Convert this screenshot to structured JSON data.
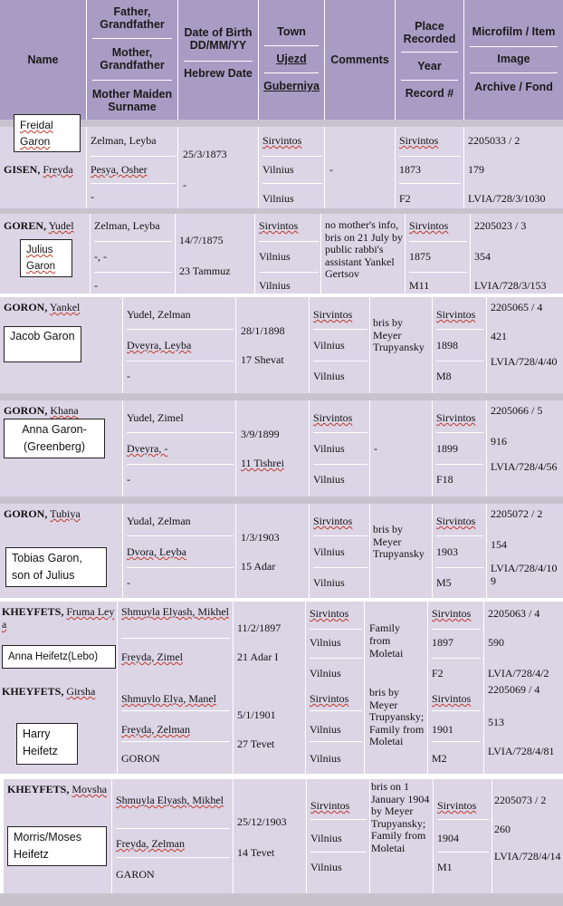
{
  "header": {
    "name": "Name",
    "father": "Father, Grandfather",
    "mother": "Mother, Grandfather",
    "maiden": "Mother Maiden Surname",
    "dob": "Date of Birth DD/MM/YY",
    "hebrew": "Hebrew Date",
    "town": "Town",
    "ujezd": "Ujezd",
    "guberniya": "Guberniya",
    "comments": "Comments",
    "place": "Place Recorded",
    "year": "Year",
    "record": "Record #",
    "microfilm": "Microfilm / Item",
    "image": "Image",
    "archive": "Archive / Fond"
  },
  "records": [
    {
      "name_last": "GISEN,",
      "name_first": "Freyda",
      "father": "Zelman, Leyba",
      "mother": "Pesya, Osher",
      "maiden": "-",
      "dob": "25/3/1873",
      "hebrew": "-",
      "town": "Sirvintos",
      "ujezd": "Vilnius",
      "guberniya": "Vilnius",
      "comments": "-",
      "place": "Sirvintos",
      "year": "1873",
      "record": "F2",
      "microfilm": "2205033 / 2",
      "image": "179",
      "archive": "LVIA/728/3/1030",
      "note": "Freidal Garon"
    },
    {
      "name_last": "GOREN,",
      "name_first": "Yudel",
      "father": "Zelman, Leyba",
      "mother": "-, -",
      "maiden": "-",
      "dob": "14/7/1875",
      "hebrew": "23 Tammuz",
      "town": "Sirvintos",
      "ujezd": "Vilnius",
      "guberniya": "Vilnius",
      "comments": "no mother's info, bris on 21 July by public rabbi's assistant Yankel Gertsov",
      "place": "Sirvintos",
      "year": "1875",
      "record": "M11",
      "microfilm": "2205023 / 3",
      "image": "354",
      "archive": "LVIA/728/3/153",
      "note": "Julius Garon"
    },
    {
      "name_last": "GORON,",
      "name_first": "Yankel",
      "father": "Yudel, Zelman",
      "mother": "Dveyra, Leyba",
      "maiden": "-",
      "dob": "28/1/1898",
      "hebrew": "17 Shevat",
      "town": "Sirvintos",
      "ujezd": "Vilnius",
      "guberniya": "Vilnius",
      "comments": "bris by Meyer Trupyansky",
      "place": "Sirvintos",
      "year": "1898",
      "record": "M8",
      "microfilm": "2205065 / 4",
      "image": "421",
      "archive": "LVIA/728/4/40",
      "note": "Jacob Garon"
    },
    {
      "name_last": "GORON,",
      "name_first": "Khana",
      "father": "Yudel, Zimel",
      "mother": "Dveyra, -",
      "maiden": "-",
      "dob": "3/9/1899",
      "hebrew": "11 Tishrei",
      "town": "Sirvintos",
      "ujezd": "Vilnius",
      "guberniya": "Vilnius",
      "comments": "-",
      "place": "Sirvintos",
      "year": "1899",
      "record": "F18",
      "microfilm": "2205066 / 5",
      "image": "916",
      "archive": "LVIA/728/4/56",
      "note": "Anna Garon-(Greenberg)"
    },
    {
      "name_last": "GORON,",
      "name_first": "Tubiya",
      "father": "Yudal, Zelman",
      "mother": "Dvora, Leyba",
      "maiden": "-",
      "dob": "1/3/1903",
      "hebrew": "15 Adar",
      "town": "Sirvintos",
      "ujezd": "Vilnius",
      "guberniya": "Vilnius",
      "comments": "bris by Meyer Trupyansky",
      "place": "Sirvintos",
      "year": "1903",
      "record": "M5",
      "microfilm": "2205072 / 2",
      "image": "154",
      "archive": "LVIA/728/4/109",
      "note": "Tobias Garon, son of Julius"
    },
    {
      "name_last": "KHEYFETS,",
      "name_first": "Fruma Leya",
      "father": "Shmuyla Elyash, Mikhel",
      "mother": "Freyda, Zimel",
      "maiden": "",
      "dob": "11/2/1897",
      "hebrew": "21 Adar I",
      "town": "Sirvintos",
      "ujezd": "Vilnius",
      "guberniya": "Vilnius",
      "comments": "Family from Moletai",
      "place": "Sirvintos",
      "year": "1897",
      "record": "F2",
      "microfilm": "2205063 / 4",
      "image": "590",
      "archive": "LVIA/728/4/2",
      "note": "Anna Heifetz(Lebo)"
    },
    {
      "name_last": "KHEYFETS,",
      "name_first": "Girsha",
      "father": "Shmuylo Elya, Manel",
      "mother": "Freyda, Zelman",
      "maiden": "GORON",
      "dob": "5/1/1901",
      "hebrew": "27 Tevet",
      "town": "Sirvintos",
      "ujezd": "Vilnius",
      "guberniya": "Vilnius",
      "comments": "bris by Meyer Trupyansky; Family from Moletai",
      "place": "Sirvintos",
      "year": "1901",
      "record": "M2",
      "microfilm": "2205069 / 4",
      "image": "513",
      "archive": "LVIA/728/4/81",
      "note": "Harry Heifetz"
    },
    {
      "name_last": "KHEYFETS,",
      "name_first": "Movsha",
      "father": "Shmuyla Elyash, Mikhel",
      "mother": "Freyda, Zelman",
      "maiden": "GARON",
      "dob": "25/12/1903",
      "hebrew": "14 Tevet",
      "town": "Sirvintos",
      "ujezd": "Vilnius",
      "guberniya": "Vilnius",
      "comments": "bris on 1 January 1904 by Meyer Trupyansky; Family from Moletai",
      "place": "Sirvintos",
      "year": "1904",
      "record": "M1",
      "microfilm": "2205073 / 2",
      "image": "260",
      "archive": "LVIA/728/4/14",
      "note": "Morris/Moses Heifetz"
    }
  ]
}
